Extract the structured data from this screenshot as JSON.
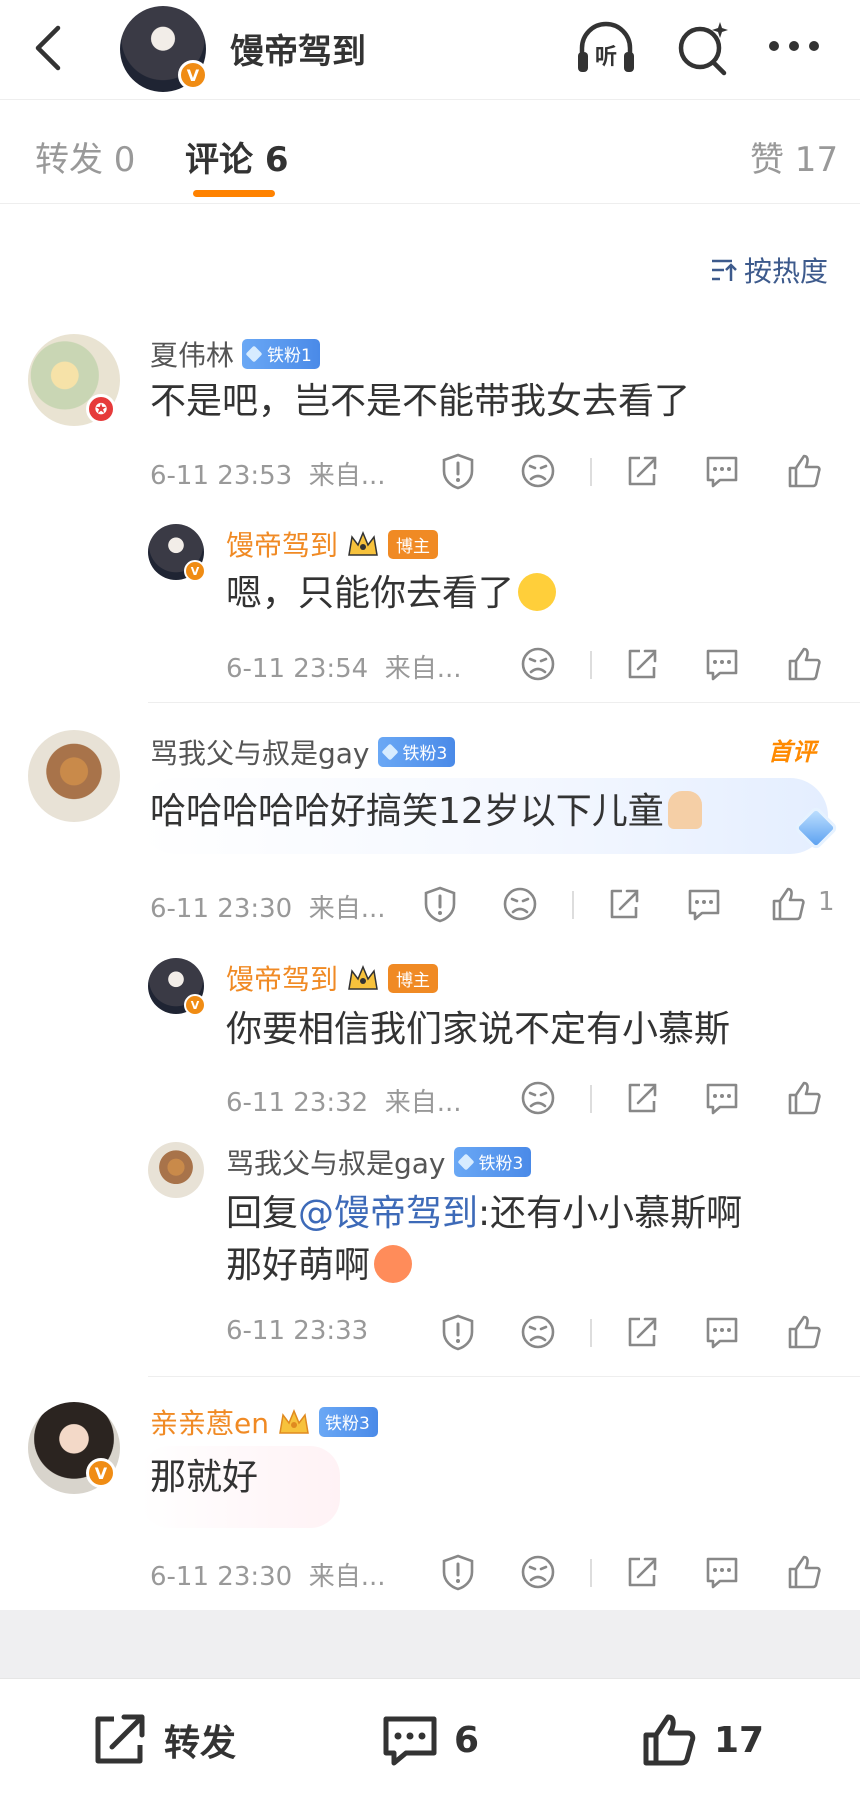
{
  "header": {
    "back_icon": "chevron-left-icon",
    "title": "馒帝驾到",
    "listen_label": "听",
    "icons": [
      "headphones-icon",
      "search-sparkle-icon",
      "more-icon"
    ]
  },
  "tabs": {
    "repost": "转发 0",
    "comment": "评论 6",
    "like": "赞 17"
  },
  "sort_label": "按热度",
  "comments": [
    {
      "user": "夏伟林",
      "badge": "铁粉1",
      "text": "不是吧，岂不是不能带我女去看了",
      "time": "6-11 23:53",
      "source": "来自...",
      "replies": [
        {
          "user": "馒帝驾到",
          "badge": "博主",
          "text": "嗯，只能你去看了",
          "time": "6-11 23:54",
          "source": "来自..."
        }
      ]
    },
    {
      "user": "骂我父与叔是gay",
      "badge": "铁粉3",
      "hot_tag": "首评",
      "text": "哈哈哈哈哈好搞笑12岁以下儿童",
      "time": "6-11 23:30",
      "source": "来自...",
      "like_count": "1",
      "replies": [
        {
          "user": "馒帝驾到",
          "badge": "博主",
          "text": "你要相信我们家说不定有小慕斯",
          "time": "6-11 23:32",
          "source": "来自..."
        },
        {
          "user": "骂我父与叔是gay",
          "badge": "铁粉3",
          "text_prefix": "回复",
          "mention": "@馒帝驾到",
          "text_line1": ":还有小小慕斯啊",
          "text_line2": "那好萌啊",
          "time": "6-11 23:33"
        }
      ]
    },
    {
      "user": "亲亲蒽en",
      "badge": "铁粉3",
      "text": "那就好",
      "time": "6-11 23:30",
      "source": "来自..."
    }
  ],
  "bottom_bar": {
    "repost": "转发",
    "comment_count": "6",
    "like_count": "17"
  },
  "colors": {
    "accent": "#ff8200",
    "name_orange": "#f08a24",
    "link_blue": "#3d6ab8",
    "fan_badge": "#4a8ae8"
  }
}
